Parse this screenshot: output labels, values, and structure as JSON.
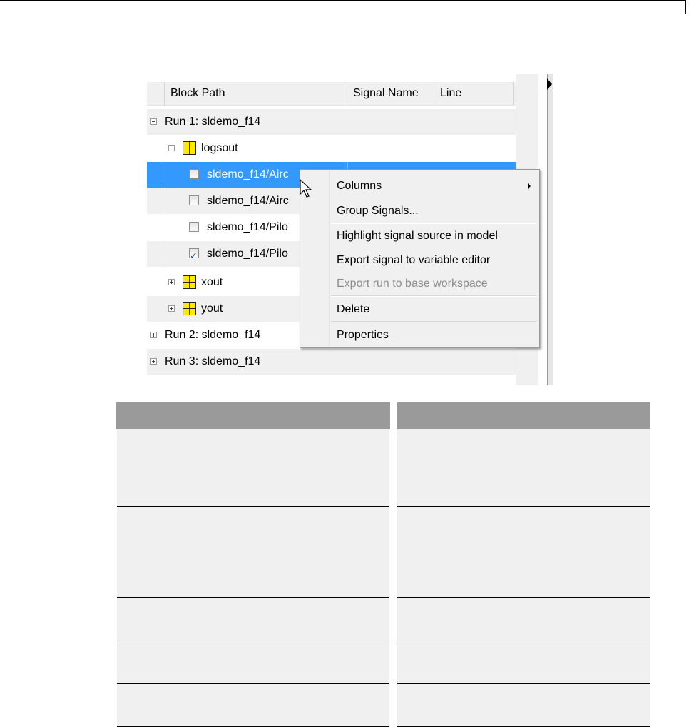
{
  "tree_header": {
    "block_path": "Block Path",
    "signal_name": "Signal Name",
    "line": "Line"
  },
  "tree_rows": {
    "run1": "Run 1: sldemo_f14",
    "logsout": "logsout",
    "sig1": "sldemo_f14/Airc",
    "sig2": "sldemo_f14/Airc",
    "sig3": "sldemo_f14/Pilo",
    "sig4": "sldemo_f14/Pilo",
    "xout": "xout",
    "yout": "yout",
    "run2": "Run 2: sldemo_f14",
    "run3": "Run 3: sldemo_f14"
  },
  "checkboxes": {
    "sig1": false,
    "sig2": false,
    "sig3": false,
    "sig4": true
  },
  "context_menu": {
    "columns": "Columns",
    "group_signals": "Group Signals...",
    "highlight": "Highlight signal source in model",
    "export_var": "Export signal to variable editor",
    "export_run": "Export run to base workspace",
    "delete": "Delete",
    "properties": "Properties"
  },
  "colors": {
    "selection": "#3399ff",
    "grid_icon": "#ffe800",
    "table_header": "#9a9a9a",
    "table_cell": "#f0f0f0"
  }
}
